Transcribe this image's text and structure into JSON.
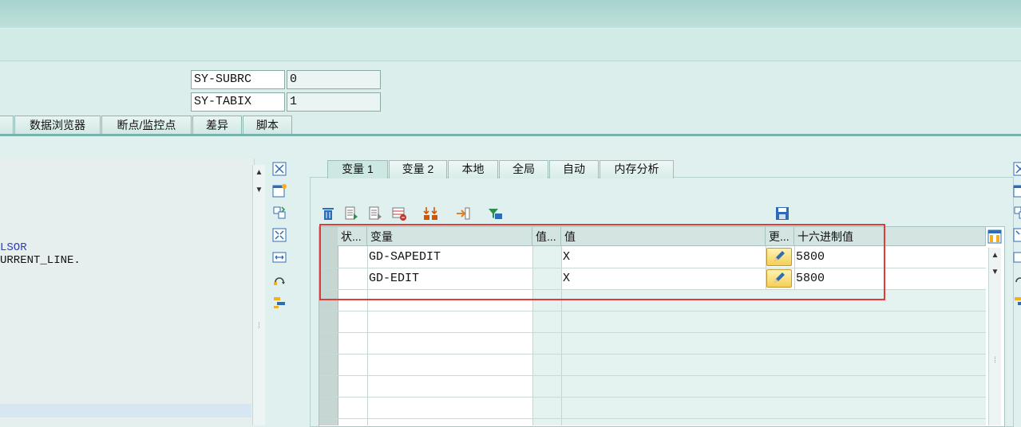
{
  "system_fields": [
    {
      "name": "SY-SUBRC",
      "value": "0"
    },
    {
      "name": "SY-TABIX",
      "value": "1"
    }
  ],
  "top_tabs": [
    "数据浏览器",
    "断点/监控点",
    "差异",
    "脚本"
  ],
  "left_code": [
    "LSOR",
    "URRENT_LINE."
  ],
  "var_tabs": [
    "变量 1",
    "变量 2",
    "本地",
    "全局",
    "自动",
    "内存分析"
  ],
  "grid": {
    "headers": [
      "状...",
      "变量",
      "值...",
      "值",
      "更...",
      "十六进制值"
    ],
    "rows": [
      {
        "variable": "GD-SAPEDIT",
        "value": "X",
        "hex": "5800"
      },
      {
        "variable": "GD-EDIT",
        "value": "X",
        "hex": "5800"
      }
    ]
  },
  "colors": {
    "accent": "#79b2aa",
    "highlight_box": "#e03a3a"
  },
  "icons": {
    "left_toolbar": [
      "fullscreen-icon",
      "new-window-icon",
      "swap-icon",
      "expand-icon",
      "resize-icon",
      "refresh-icon",
      "tools-icon"
    ],
    "grid_toolbar": [
      "delete-icon",
      "add-icon",
      "doc-icon",
      "insert-row-icon",
      "sort-icon",
      "export-icon",
      "filter-icon",
      "save-icon"
    ]
  }
}
